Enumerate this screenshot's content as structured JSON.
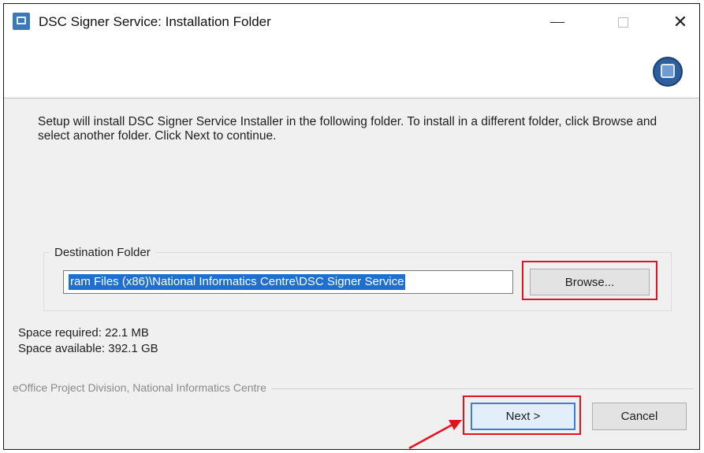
{
  "window": {
    "title": "DSC Signer Service: Installation Folder",
    "controls": {
      "minimize": "—",
      "maximize": "□",
      "close": "✕"
    }
  },
  "description": "Setup will install DSC Signer Service Installer in the following folder. To install in a different folder, click Browse and select another folder. Click Next to continue.",
  "destination": {
    "group_label": "Destination Folder",
    "path_value": "ram Files (x86)\\National Informatics Centre\\DSC Signer Service",
    "browse_label": "Browse..."
  },
  "space": {
    "required": "Space required: 22.1 MB",
    "available": "Space available: 392.1 GB"
  },
  "footer": {
    "branding": "eOffice Project Division, National Informatics Centre"
  },
  "buttons": {
    "next": "Next >",
    "cancel": "Cancel"
  },
  "annotations": {
    "highlight_color": "#e0141e",
    "arrow_color": "#e0141e"
  },
  "colors": {
    "selection": "#1e6fd0",
    "logo": "#2b5f9e"
  },
  "icons": {
    "app": "installer-app-icon",
    "logo": "dsc-signer-logo-icon"
  }
}
